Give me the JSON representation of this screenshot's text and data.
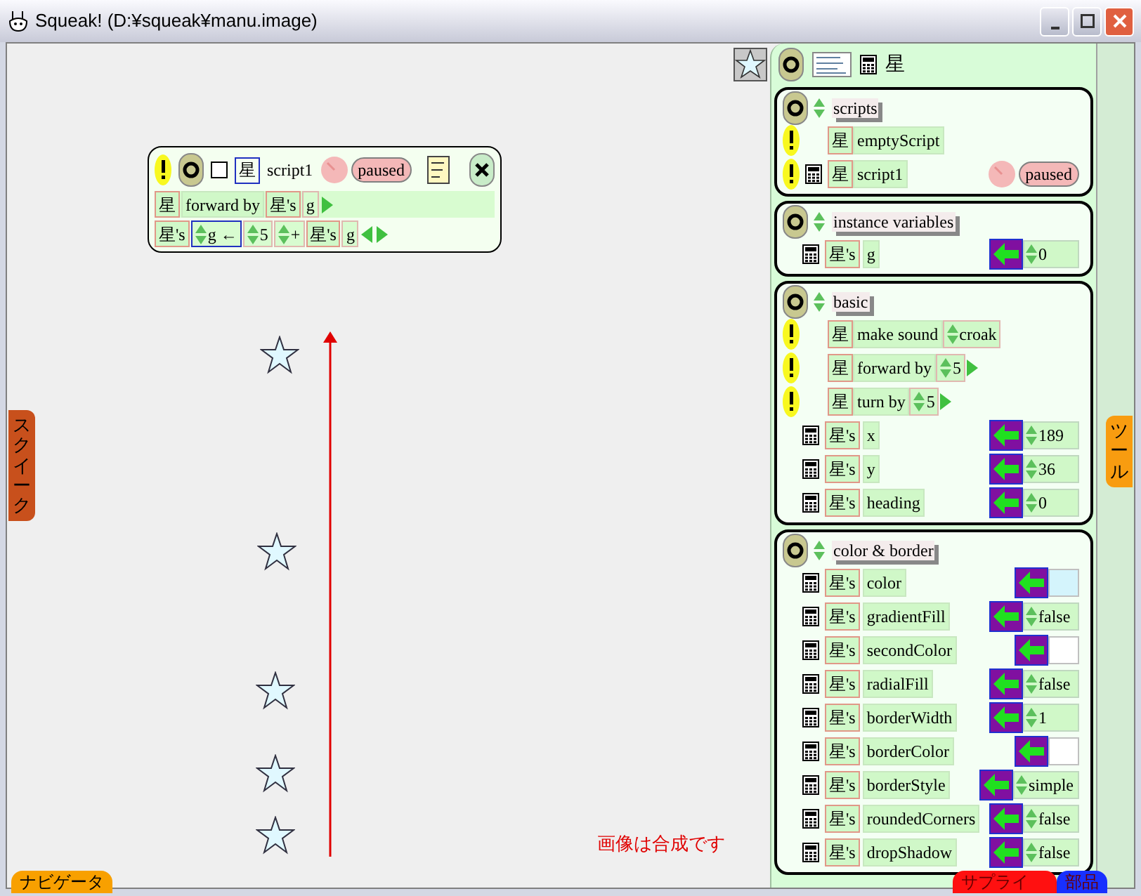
{
  "window": {
    "title": "Squeak! (D:¥squeak¥manu.image)"
  },
  "canvas": {
    "annotation": "画像は合成です"
  },
  "script_editor": {
    "player": "星",
    "name": "script1",
    "status": "paused",
    "checked": false,
    "rows": [
      {
        "kind": "command",
        "tiles": [
          {
            "kind": "player",
            "text": "星",
            "arrows": false
          },
          {
            "kind": "phrase",
            "text": "forward by",
            "arrows": false
          },
          {
            "kind": "player",
            "text": "星's",
            "arrows": false
          },
          {
            "kind": "plain",
            "text": "g",
            "arrows": false
          }
        ]
      },
      {
        "kind": "assignment",
        "tiles": [
          {
            "kind": "player",
            "text": "星's",
            "arrows": false
          },
          {
            "kind": "assign",
            "text": "g ←",
            "arrows": true
          },
          {
            "kind": "plain",
            "text": "5",
            "arrows": true
          },
          {
            "kind": "plain",
            "text": "+",
            "arrows": true
          },
          {
            "kind": "player",
            "text": "星's",
            "arrows": false
          },
          {
            "kind": "plain",
            "text": "g",
            "arrows": false
          }
        ]
      }
    ]
  },
  "viewer": {
    "player": "星",
    "sections": [
      {
        "title": "scripts",
        "rows": [
          {
            "kind": "script",
            "calc": false,
            "player": "星",
            "name": "emptyScript"
          },
          {
            "kind": "script",
            "calc": true,
            "player": "星",
            "name": "script1",
            "status": "paused"
          }
        ]
      },
      {
        "title": "instance variables",
        "rows": [
          {
            "kind": "variable",
            "player": "星's",
            "name": "g",
            "value": "0",
            "arrows": true
          }
        ]
      },
      {
        "title": "basic",
        "rows": [
          {
            "kind": "command",
            "player": "星",
            "name": "make sound",
            "arg": "croak",
            "run": false
          },
          {
            "kind": "command",
            "player": "星",
            "name": "forward by",
            "arg": "5",
            "run": true
          },
          {
            "kind": "command",
            "player": "星",
            "name": "turn by",
            "arg": "5",
            "run": true
          },
          {
            "kind": "variable",
            "player": "星's",
            "name": "x",
            "value": "189",
            "arrows": true
          },
          {
            "kind": "variable",
            "player": "星's",
            "name": "y",
            "value": "36",
            "arrows": true
          },
          {
            "kind": "variable",
            "player": "星's",
            "name": "heading",
            "value": "0",
            "arrows": true
          }
        ]
      },
      {
        "title": "color & border",
        "rows": [
          {
            "kind": "swatch",
            "player": "星's",
            "name": "color",
            "color": "#d4f4fc"
          },
          {
            "kind": "variable",
            "player": "星's",
            "name": "gradientFill",
            "value": "false",
            "arrows": true
          },
          {
            "kind": "swatch",
            "player": "星's",
            "name": "secondColor",
            "color": "#ffffff"
          },
          {
            "kind": "variable",
            "player": "星's",
            "name": "radialFill",
            "value": "false",
            "arrows": true
          },
          {
            "kind": "variable",
            "player": "星's",
            "name": "borderWidth",
            "value": "1",
            "arrows": true
          },
          {
            "kind": "swatch",
            "player": "星's",
            "name": "borderColor",
            "color": "#ffffff"
          },
          {
            "kind": "variable",
            "player": "星's",
            "name": "borderStyle",
            "value": "simple",
            "arrows": true
          },
          {
            "kind": "variable",
            "player": "星's",
            "name": "roundedCorners",
            "value": "false",
            "arrows": true
          },
          {
            "kind": "variable",
            "player": "星's",
            "name": "dropShadow",
            "value": "false",
            "arrows": true
          }
        ]
      }
    ]
  },
  "flaps": [
    {
      "kind": "left",
      "label": "スクイーク",
      "color": "#c8501c"
    },
    {
      "kind": "right",
      "label": "ツール",
      "color": "#f89c10"
    },
    {
      "kind": "bottom",
      "label": "ナビゲータ",
      "color": "#f8a000"
    },
    {
      "kind": "bottom",
      "label": "サプライ",
      "color": "#ff1010"
    },
    {
      "kind": "bottom",
      "label": "部品",
      "color": "#1830ff"
    }
  ]
}
